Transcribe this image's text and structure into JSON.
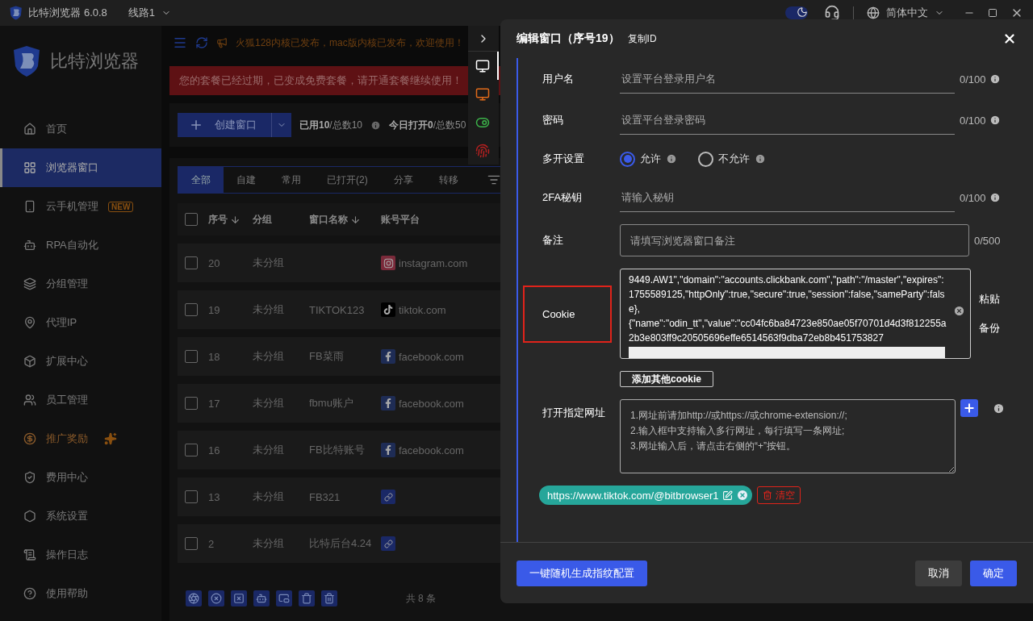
{
  "titlebar": {
    "app_name": "比特浏览器 6.0.8",
    "line": "线路1",
    "language": "简体中文",
    "dark_mode": true
  },
  "sidebar": {
    "brand": "比特浏览器",
    "items": [
      {
        "kind": "home",
        "label": "首页",
        "selected": false,
        "highlighted": false
      },
      {
        "kind": "windows",
        "label": "浏览器窗口",
        "selected": true,
        "highlighted": false
      },
      {
        "kind": "phone",
        "label": "云手机管理",
        "selected": false,
        "highlighted": false,
        "badge": "NEW"
      },
      {
        "kind": "rpa",
        "label": "RPA自动化",
        "selected": false,
        "highlighted": false
      },
      {
        "kind": "groups",
        "label": "分组管理",
        "selected": false,
        "highlighted": false
      },
      {
        "kind": "proxy",
        "label": "代理IP",
        "selected": false,
        "highlighted": false
      },
      {
        "kind": "extensions",
        "label": "扩展中心",
        "selected": false,
        "highlighted": false
      },
      {
        "kind": "staff",
        "label": "员工管理",
        "selected": false,
        "highlighted": false
      },
      {
        "kind": "referral",
        "label": "推广奖励",
        "selected": false,
        "highlighted": true
      },
      {
        "kind": "billing",
        "label": "费用中心",
        "selected": false,
        "highlighted": false
      },
      {
        "kind": "settings",
        "label": "系统设置",
        "selected": false,
        "highlighted": false
      },
      {
        "kind": "logs",
        "label": "操作日志",
        "selected": false,
        "highlighted": false
      },
      {
        "kind": "help",
        "label": "使用帮助",
        "selected": false,
        "highlighted": false
      }
    ]
  },
  "announcement": "火狐128内核已发布，mac版内核已发布，欢迎使用！",
  "alert": "您的套餐已经过期，已变成免费套餐，请开通套餐继续使用！",
  "create_button": "创建窗口",
  "usage": [
    "**已用10**/总数10",
    "**今日打开0**/总数50"
  ],
  "tabs": [
    {
      "label": "全部",
      "selected": true
    },
    {
      "label": "自建",
      "selected": false
    },
    {
      "label": "常用",
      "selected": false
    },
    {
      "label": "已打开(2)",
      "selected": false
    },
    {
      "label": "分享",
      "selected": false
    },
    {
      "label": "转移",
      "selected": false
    }
  ],
  "table": {
    "all_checked": false,
    "columns": [
      {
        "label": "序号",
        "sortable": true
      },
      {
        "label": "分组",
        "sortable": false
      },
      {
        "label": "窗口名称",
        "sortable": true
      },
      {
        "label": "账号平台",
        "sortable": false
      }
    ],
    "rows": [
      {
        "number": "20",
        "group": "未分组",
        "platform": {
          "kind": "instagram",
          "text": "instagram.com"
        },
        "checked": false
      },
      {
        "number": "19",
        "group": "未分组",
        "name": "TIKTOK123",
        "platform": {
          "kind": "tiktok",
          "text": "tiktok.com"
        },
        "checked": false
      },
      {
        "number": "18",
        "group": "未分组",
        "name": "FB菜雨",
        "platform": {
          "kind": "facebook",
          "text": "facebook.com"
        },
        "checked": false
      },
      {
        "number": "17",
        "group": "未分组",
        "name": "fbmu账户",
        "platform": {
          "kind": "facebook",
          "text": "facebook.com"
        },
        "checked": false
      },
      {
        "number": "16",
        "group": "未分组",
        "name": "FB比特账号",
        "platform": {
          "kind": "facebook",
          "text": "facebook.com"
        },
        "checked": false
      },
      {
        "number": "13",
        "group": "未分组",
        "name": "FB321",
        "platform": {
          "kind": "link"
        },
        "checked": false
      },
      {
        "number": "2",
        "group": "未分组",
        "name": "比特后台4.24",
        "platform": {
          "kind": "link"
        },
        "checked": false
      }
    ]
  },
  "total": "共 8 条",
  "side_tools": [
    {
      "kind": "display",
      "selected": true
    },
    {
      "kind": "ip",
      "selected": false
    },
    {
      "kind": "toggle",
      "selected": false
    },
    {
      "kind": "fingerprint",
      "selected": false
    }
  ],
  "drawer": {
    "title": "编辑窗口（序号19）",
    "copy_id": "复制ID",
    "fields": [
      {
        "kind": "input",
        "label": "用户名",
        "placeholder": "设置平台登录用户名",
        "counter": "0/100"
      },
      {
        "kind": "input",
        "label": "密码",
        "placeholder": "设置平台登录密码",
        "counter": "0/100"
      },
      {
        "kind": "radio",
        "label": "多开设置",
        "options": [
          {
            "label": "允许",
            "selected": true
          },
          {
            "label": "不允许",
            "selected": false
          }
        ]
      },
      {
        "kind": "input",
        "label": "2FA秘钥",
        "placeholder": "请输入秘钥",
        "counter": "0/100"
      },
      {
        "kind": "remark",
        "label": "备注",
        "placeholder": "请填写浏览器窗口备注",
        "counter": "0/500"
      },
      {
        "kind": "cookie",
        "label": "Cookie",
        "highlighted": true,
        "value": "9449.AW1\",\"domain\":\"accounts.clickbank.com\",\"path\":\"/master\",\"expires\":1755589125,\"httpOnly\":true,\"secure\":true,\"session\":false,\"sameParty\":false},\n{\"name\":\"odin_tt\",\"value\":\"cc04fc6ba84723e850ae05f70701d4d3f812255a2b3e803ff9c20505696effe6514563f9dba72eb8b451753827",
        "actions": [
          "粘贴",
          "备份"
        ],
        "add_button": "添加其他cookie"
      },
      {
        "kind": "urls",
        "label": "打开指定网址",
        "placeholder": "1.网址前请加http://或https://或chrome-extension://;\n2.输入框中支持输入多行网址，每行填写一条网址;\n3.网址输入后，请点击右侧的“+”按钮。",
        "tags": [
          "https://www.tiktok.com/@bitbrowser1"
        ],
        "clear": "清空"
      }
    ]
  },
  "footer": {
    "random_button": "一键随机生成指纹配置",
    "cancel": "取消",
    "confirm": "确定"
  }
}
